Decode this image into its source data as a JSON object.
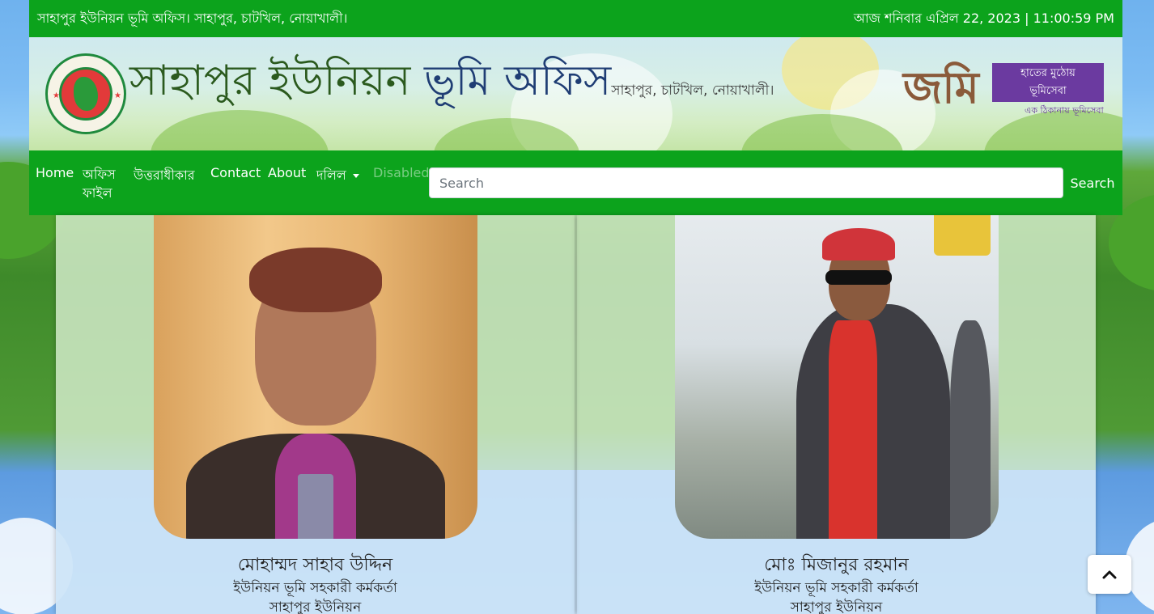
{
  "topbar": {
    "left_text": "সাহাপুর ইউনিয়ন ভূমি অফিস। সাহাপুর, চাটখিল, নোয়াখালী।",
    "datetime": "আজ শনিবার এপ্রিল 22, 2023 | 11:00:59 PM"
  },
  "banner": {
    "title_part1": "সাহাপুর ইউনিয়ন",
    "title_part2": "ভূমি অফিস",
    "subtitle": "সাহাপুর, চাটখিল, নোয়াখালী।",
    "jomi_logo": "জমি",
    "jomi_slogan_1": "হাতের মুঠোয়",
    "jomi_slogan_2": "ভূমিসেবা",
    "jomi_tag": "এক ঠিকানায় ভূমিসেবা"
  },
  "nav": {
    "home": "Home",
    "office_file_1": "অফিস",
    "office_file_2": "ফাইল",
    "inheritance": "উত্তরাধীকার",
    "contact": "Contact",
    "about": "About",
    "deed": "দলিল",
    "disabled": "Disabled",
    "search_placeholder": "Search",
    "search_value": "",
    "search_button": "Search"
  },
  "officers": [
    {
      "name": "মোহাম্মদ সাহাব উদ্দিন",
      "designation": "ইউনিয়ন ভূমি সহকারী কর্মকর্তা",
      "union": "সাহাপুর ইউনিয়ন"
    },
    {
      "name": "মোঃ মিজানুর রহমান",
      "designation": "ইউনিয়ন ভূমি সহকারী কর্মকর্তা",
      "union": "সাহাপুর ইউনিয়ন"
    }
  ],
  "scroll_top": {
    "icon": "chevron-up-icon"
  },
  "colors": {
    "primary_green": "#0ca31c",
    "title_green": "#2b5a1e",
    "title_blue": "#1f3d74"
  }
}
